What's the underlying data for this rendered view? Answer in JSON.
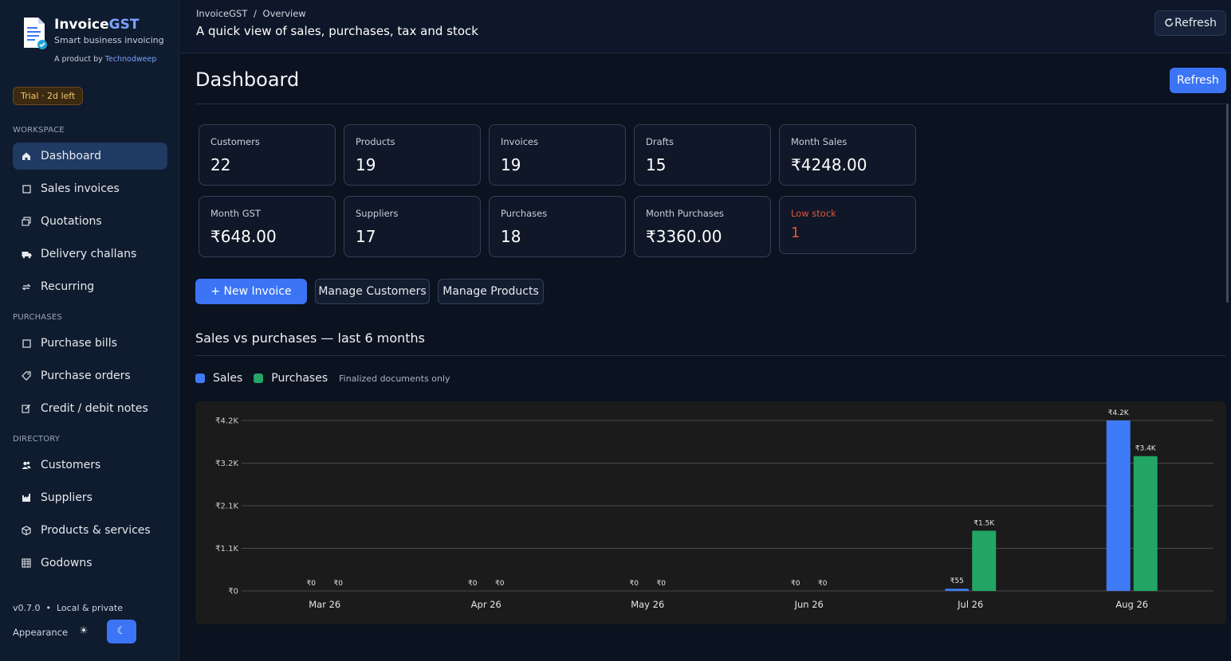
{
  "brand": {
    "name_main": "Invoice",
    "name_accent": "GST",
    "tagline": "Smart business invoicing",
    "by_prefix": "A product by ",
    "by_link": "Technodweep"
  },
  "trial_badge": "Trial · 2d left",
  "sidebar": {
    "sections": [
      {
        "label": "WORKSPACE",
        "items": [
          {
            "label": "Dashboard",
            "icon": "home-icon",
            "active": true
          },
          {
            "label": "Sales invoices",
            "icon": "square-icon"
          },
          {
            "label": "Quotations",
            "icon": "stack-icon"
          },
          {
            "label": "Delivery challans",
            "icon": "truck-icon"
          },
          {
            "label": "Recurring",
            "icon": "repeat-icon"
          }
        ]
      },
      {
        "label": "PURCHASES",
        "items": [
          {
            "label": "Purchase bills",
            "icon": "square-icon"
          },
          {
            "label": "Purchase orders",
            "icon": "tag-icon"
          },
          {
            "label": "Credit / debit notes",
            "icon": "note-icon"
          }
        ]
      },
      {
        "label": "DIRECTORY",
        "items": [
          {
            "label": "Customers",
            "icon": "users-icon"
          },
          {
            "label": "Suppliers",
            "icon": "factory-icon"
          },
          {
            "label": "Products & services",
            "icon": "box-icon"
          },
          {
            "label": "Godowns",
            "icon": "warehouse-icon"
          }
        ]
      }
    ],
    "version": "v0.7.0",
    "storage": "Local & private",
    "appearance_label": "Appearance"
  },
  "header": {
    "breadcrumb_app": "InvoiceGST",
    "breadcrumb_sep": "/",
    "breadcrumb_page": "Overview",
    "subtitle": "A quick view of sales, purchases, tax and stock",
    "refresh_label": "Refresh"
  },
  "main": {
    "title": "Dashboard",
    "refresh_label": "Refresh",
    "stats": [
      {
        "label": "Customers",
        "value": "22"
      },
      {
        "label": "Products",
        "value": "19"
      },
      {
        "label": "Invoices",
        "value": "19"
      },
      {
        "label": "Drafts",
        "value": "15"
      },
      {
        "label": "Month Sales",
        "value": "₹4248.00"
      },
      {
        "label": "Month GST",
        "value": "₹648.00"
      },
      {
        "label": "Suppliers",
        "value": "17"
      },
      {
        "label": "Purchases",
        "value": "18"
      },
      {
        "label": "Month Purchases",
        "value": "₹3360.00"
      },
      {
        "label": "Low stock",
        "value": "1",
        "warning": true
      }
    ],
    "actions": {
      "new_invoice": "+ New Invoice",
      "manage_customers": "Manage Customers",
      "manage_products": "Manage Products"
    },
    "chart_section": {
      "title": "Sales vs purchases — last 6 months",
      "note": "Finalized documents only"
    }
  },
  "colors": {
    "accent": "#3b74f5",
    "sales": "#3f7bf7",
    "purchases": "#22a565",
    "warning": "#e0563b"
  },
  "chart_data": {
    "type": "bar",
    "categories": [
      "Mar 26",
      "Apr 26",
      "May 26",
      "Jun 26",
      "Jul 26",
      "Aug 26"
    ],
    "series": [
      {
        "name": "Sales",
        "values": [
          0,
          0,
          0,
          0,
          55,
          4248
        ],
        "labels": [
          "₹0",
          "₹0",
          "₹0",
          "₹0",
          "₹55",
          "₹4.2K"
        ]
      },
      {
        "name": "Purchases",
        "values": [
          0,
          0,
          0,
          0,
          1500,
          3360
        ],
        "labels": [
          "₹0",
          "₹0",
          "₹0",
          "₹0",
          "₹1.5K",
          "₹3.4K"
        ]
      }
    ],
    "yticks": [
      {
        "value": 0,
        "label": "₹0"
      },
      {
        "value": 1062,
        "label": "₹1.1K"
      },
      {
        "value": 2124,
        "label": "₹2.1K"
      },
      {
        "value": 3186,
        "label": "₹3.2K"
      },
      {
        "value": 4248,
        "label": "₹4.2K"
      }
    ],
    "ylim": [
      0,
      4248
    ],
    "grid": true,
    "legend": "top-left"
  }
}
